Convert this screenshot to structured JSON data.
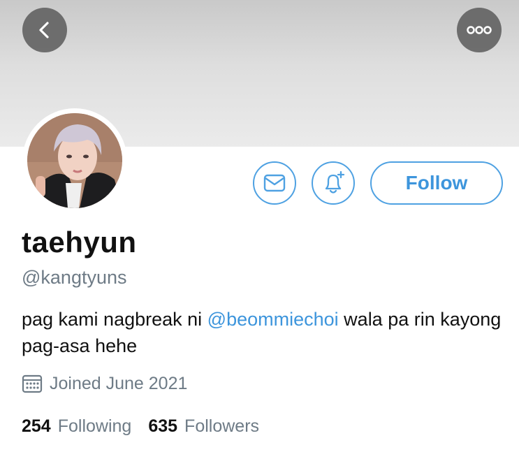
{
  "header": {
    "back_icon": "chevron-left-icon",
    "more_icon": "more-options-icon"
  },
  "profile": {
    "name": "taehyun",
    "handle": "@kangtyuns",
    "bio_before": "pag kami nagbreak ni ",
    "bio_mention": "@beommiechoi",
    "bio_after": " wala pa rin kayong pag-asa hehe",
    "joined": "Joined June 2021",
    "following_count": "254",
    "following_label": "Following",
    "followers_count": "635",
    "followers_label": "Followers"
  },
  "actions": {
    "message_icon": "envelope-icon",
    "notify_icon": "bell-plus-icon",
    "follow_label": "Follow"
  },
  "colors": {
    "accent": "#3d95dc",
    "secondary_text": "#6e7b86"
  }
}
